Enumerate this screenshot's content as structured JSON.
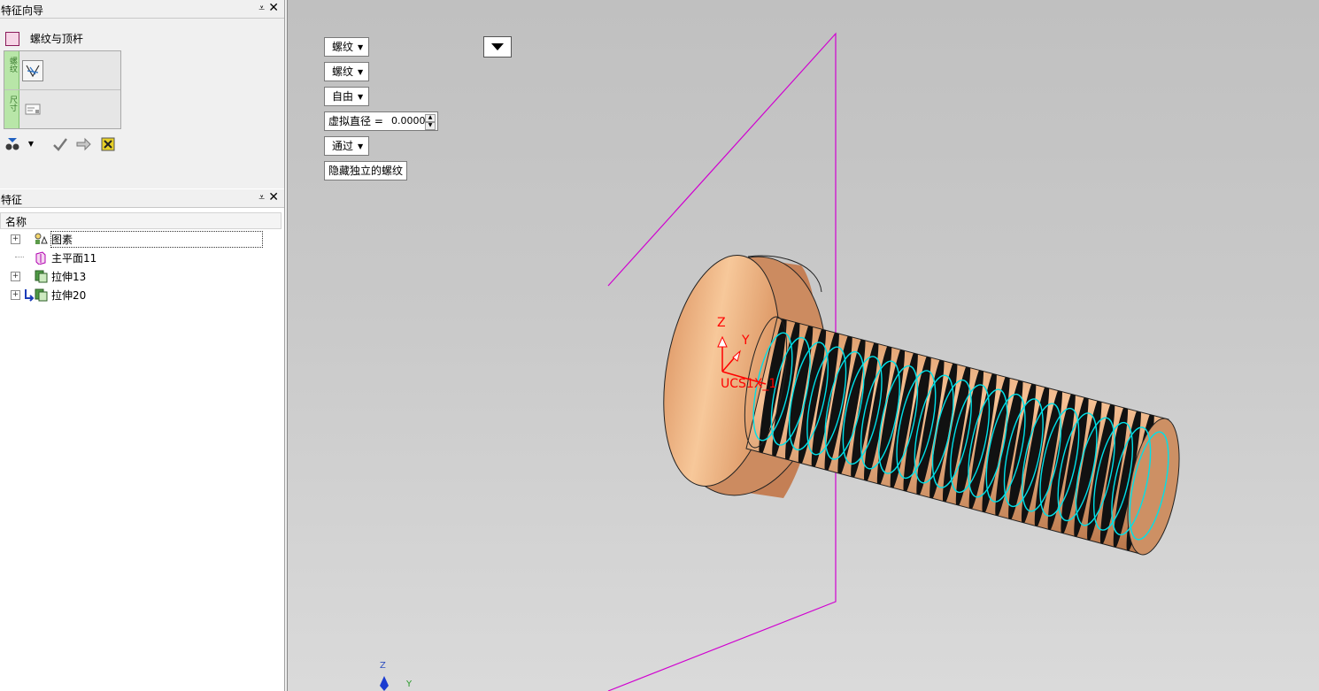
{
  "wizard_panel": {
    "title": "特征向导",
    "pin": "⩡",
    "close": "✕"
  },
  "wizard": {
    "feature_name": "螺纹与顶杆",
    "step1_tab": "螺纹",
    "step2_tab": "尺寸"
  },
  "feature_panel": {
    "title": "特征",
    "column_header": "名称"
  },
  "tree": [
    {
      "label": "图素",
      "expandable": true
    },
    {
      "label": "主平面11",
      "expandable": false
    },
    {
      "label": "拉伸13",
      "expandable": true
    },
    {
      "label": "拉伸20",
      "expandable": true
    }
  ],
  "controls": {
    "thread_type": "螺纹",
    "thread_type2": "螺纹",
    "mode": "自由",
    "virtual_diameter_label": "虚拟直径 =",
    "virtual_diameter_value": "0.0000",
    "through": "通过",
    "hide_button": "隐藏独立的螺纹"
  },
  "scene": {
    "ucs_label": "UCS1X_1",
    "axis_z": "Z",
    "axis_y": "Y",
    "mini_triad_z": "Z",
    "mini_triad_y": "Y"
  },
  "colors": {
    "plane": "#d000d0",
    "helix": "#00e0e8",
    "body": "#e9a77c",
    "axis": "#ff0000"
  }
}
